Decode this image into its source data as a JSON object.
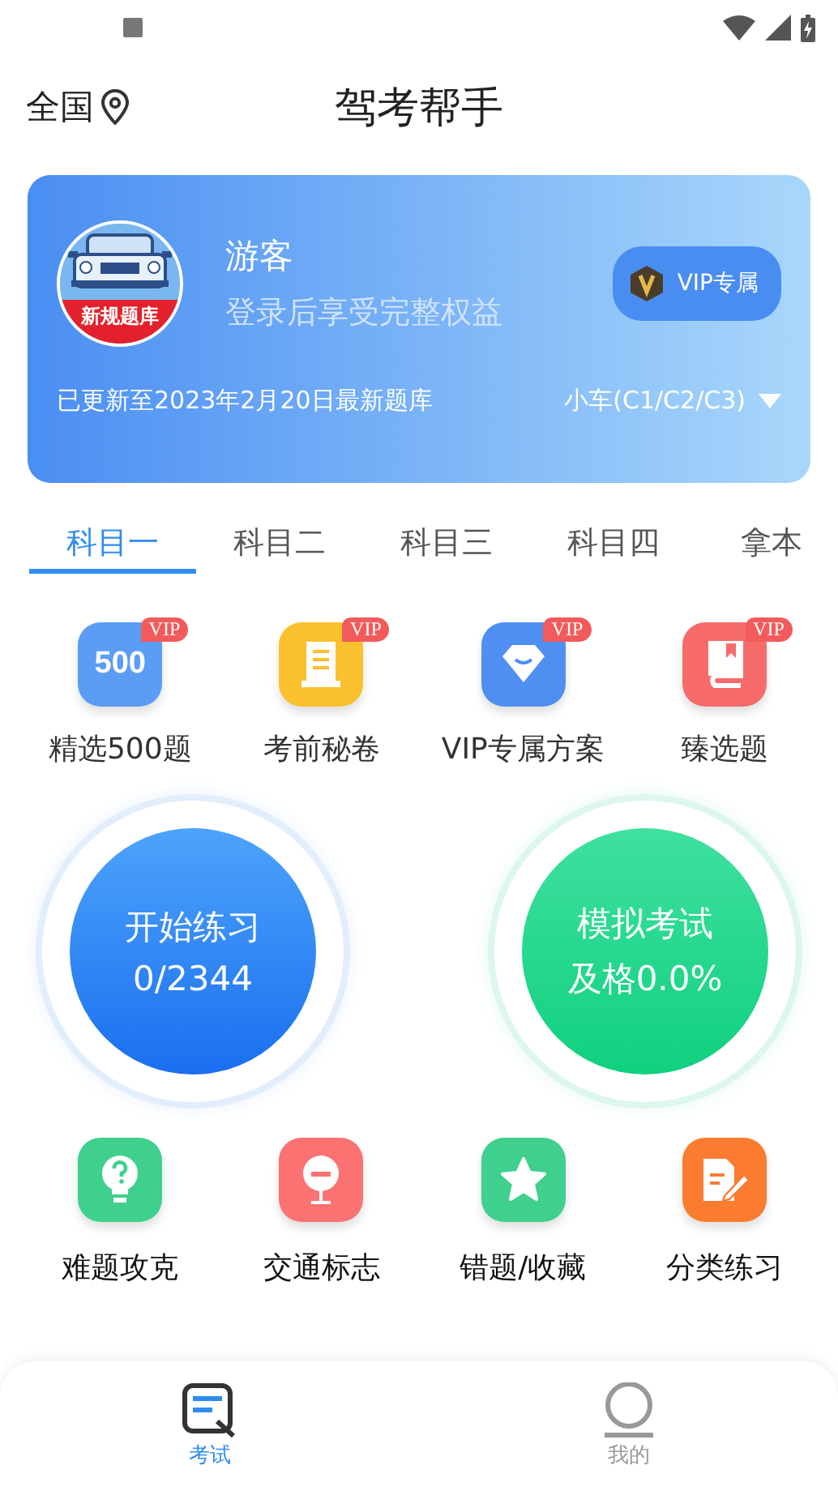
{
  "header": {
    "location": "全国",
    "title": "驾考帮手"
  },
  "profile": {
    "name": "游客",
    "subtitle": "登录后享受完整权益",
    "vip_button": "VIP专属",
    "update_note": "已更新至2023年2月20日最新题库",
    "vehicle": "小车(C1/C2/C3)",
    "avatar_caption": "新规题库"
  },
  "subjects": [
    {
      "label": "科目一",
      "selected": true
    },
    {
      "label": "科目二",
      "selected": false
    },
    {
      "label": "科目三",
      "selected": false
    },
    {
      "label": "科目四",
      "selected": false
    },
    {
      "label": "拿本",
      "selected": false
    }
  ],
  "featured": [
    {
      "kind": "num",
      "label": "精选500题",
      "icon_text": "500",
      "badge": "VIP",
      "color": "#5b9cf5"
    },
    {
      "kind": "scroll",
      "label": "考前秘卷",
      "badge": "VIP",
      "color": "#fbc02d"
    },
    {
      "kind": "diamond",
      "label": "VIP专属方案",
      "badge": "VIP",
      "color": "#4f8ff2"
    },
    {
      "kind": "book",
      "label": "臻选题",
      "badge": "VIP",
      "color": "#f86b6b"
    }
  ],
  "practice": [
    {
      "kind": "blue",
      "title": "开始练习",
      "detail": "0/2344"
    },
    {
      "kind": "green",
      "title": "模拟考试",
      "detail": "及格0.0%"
    }
  ],
  "tools": [
    {
      "kind": "bulb",
      "label": "难题攻克",
      "color": "#3fd08e"
    },
    {
      "kind": "sign",
      "label": "交通标志",
      "color": "#fb7272"
    },
    {
      "kind": "star",
      "label": "错题/收藏",
      "color": "#3fd08e"
    },
    {
      "kind": "note",
      "label": "分类练习",
      "color": "#fb7c30"
    }
  ],
  "tab_bar": [
    {
      "kind": "exam",
      "label": "考试",
      "selected": true
    },
    {
      "kind": "me",
      "label": "我的",
      "selected": false
    }
  ]
}
